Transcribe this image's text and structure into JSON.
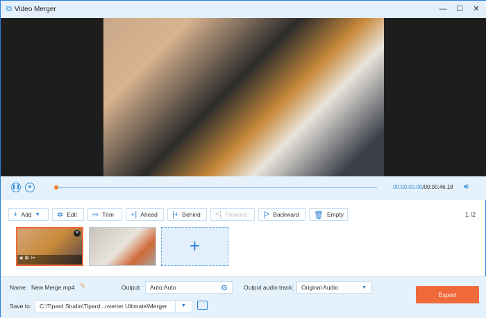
{
  "window": {
    "title": "Video Merger",
    "minimize": "—",
    "maximize": "☐",
    "close": "✕"
  },
  "player": {
    "current_time": "00:00:00.00",
    "total_time": "/00:00:46.18",
    "progress": 0
  },
  "toolbar": {
    "add": "Add",
    "edit": "Edit",
    "trim": "Trim",
    "ahead": "Ahead",
    "behind": "Behind",
    "forward": "Forward",
    "backward": "Backward",
    "empty": "Empty",
    "page_current": "1",
    "page_total": "2"
  },
  "clips": [
    {
      "selected": true
    },
    {
      "selected": false
    }
  ],
  "bottom": {
    "name_label": "Name:",
    "name_value": "New Merge.mp4",
    "output_label": "Output:",
    "output_value": "Auto;Auto",
    "audio_label": "Output audio track:",
    "audio_value": "Original Audio",
    "save_label": "Save to:",
    "save_value": "C:\\Tipard Studio\\Tipard...nverter Ultimate\\Merger",
    "export": "Export"
  },
  "colors": {
    "accent": "#2a7fd4",
    "export": "#f0693a",
    "selected_clip": "#f0693a"
  }
}
